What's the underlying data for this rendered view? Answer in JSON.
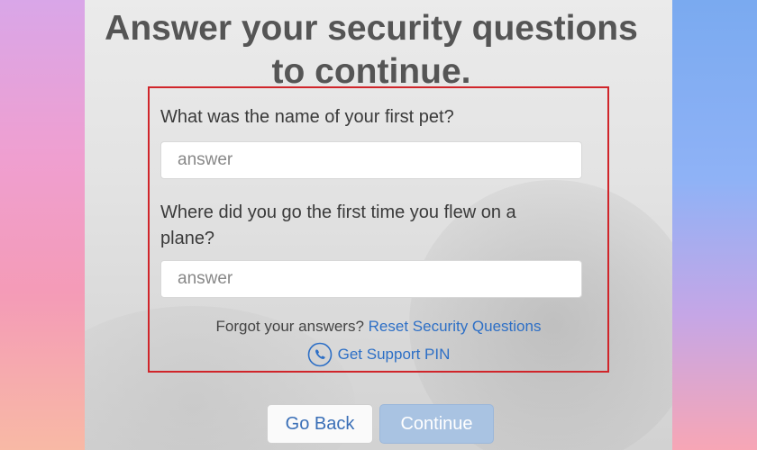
{
  "header": {
    "title_line1": "Answer your security questions",
    "title_line2": "to continue."
  },
  "questions": [
    {
      "label": "What was the name of your first pet?",
      "placeholder": "answer",
      "value": ""
    },
    {
      "label_line1": "Where did you go the first time you flew on a",
      "label_line2": "plane?",
      "placeholder": "answer",
      "value": ""
    }
  ],
  "help": {
    "forgot_text": "Forgot your answers?",
    "reset_link": "Reset Security Questions",
    "support_icon": "phone-icon",
    "support_link": "Get Support PIN"
  },
  "actions": {
    "back_label": "Go Back",
    "continue_label": "Continue",
    "continue_enabled": false
  },
  "colors": {
    "highlight_border": "#d0252a",
    "link": "#2d6fc6",
    "continue_disabled_bg": "#a9c3e2"
  }
}
